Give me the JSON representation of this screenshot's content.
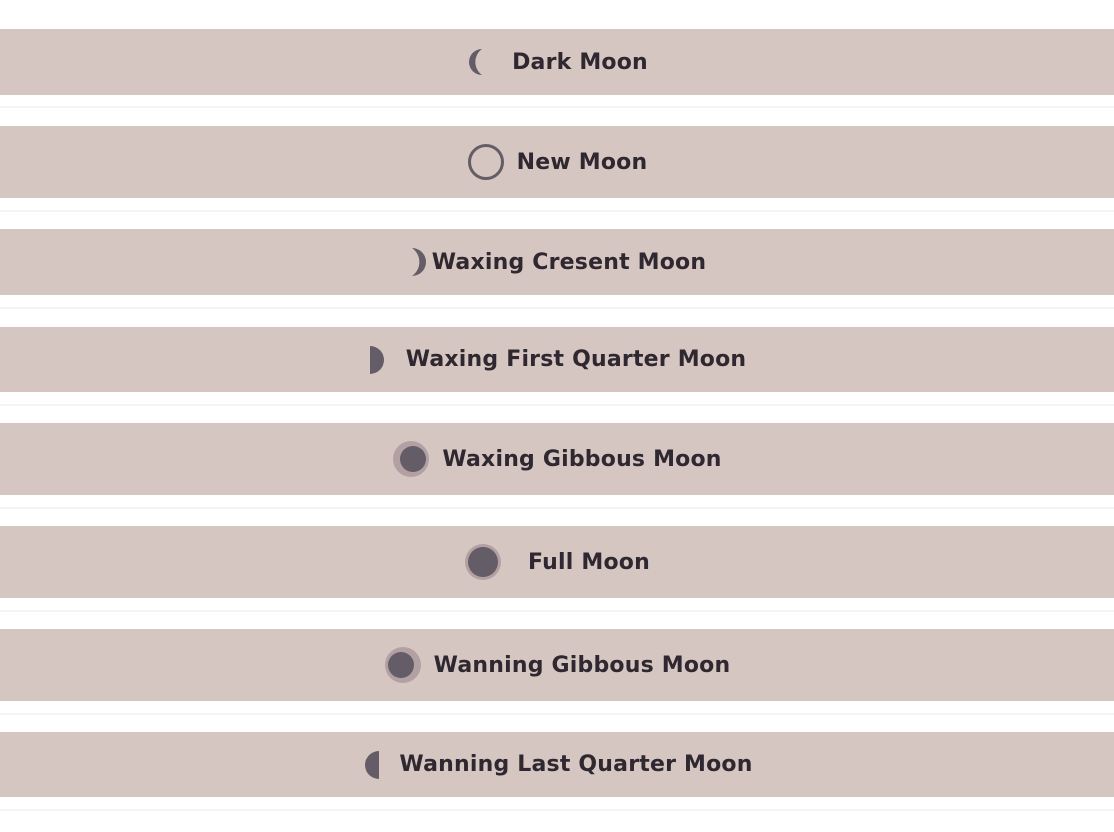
{
  "phases": [
    {
      "label": "Dark Moon",
      "icon": "dark-moon-crescent-icon"
    },
    {
      "label": "New Moon",
      "icon": "new-moon-ring-icon"
    },
    {
      "label": "Waxing Cresent Moon",
      "icon": "waxing-crescent-moon-icon"
    },
    {
      "label": "Waxing First Quarter Moon",
      "icon": "first-quarter-moon-icon"
    },
    {
      "label": "Waxing Gibbous Moon",
      "icon": "waxing-gibbous-moon-icon"
    },
    {
      "label": "Full Moon",
      "icon": "full-moon-icon"
    },
    {
      "label": "Wanning Gibbous Moon",
      "icon": "waning-gibbous-moon-icon"
    },
    {
      "label": "Wanning Last Quarter Moon",
      "icon": "last-quarter-moon-icon"
    }
  ],
  "colors": {
    "band": "#d6c6c1",
    "moon_fill": "#645c66",
    "moon_halo": "#b2a0a3",
    "text": "#2f2830",
    "background": "#ffffff"
  }
}
